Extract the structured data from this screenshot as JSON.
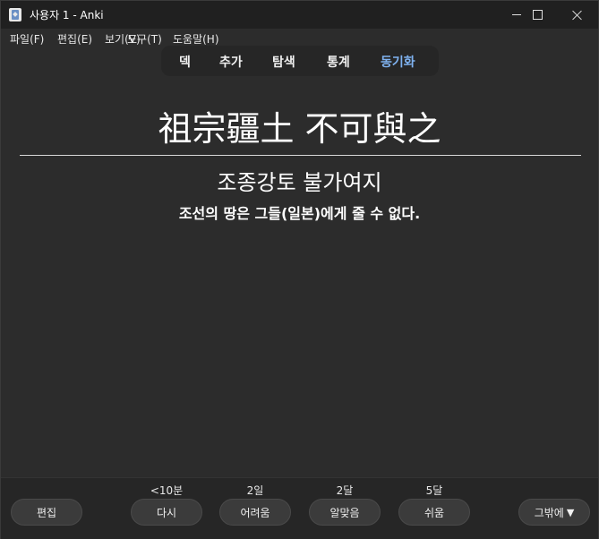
{
  "window": {
    "title": "사용자 1 - Anki",
    "icon": "anki-app-icon"
  },
  "menu": {
    "items": [
      {
        "label": "파일(F)"
      },
      {
        "label": "편집(E)"
      },
      {
        "label": "보기(V)"
      },
      {
        "label": "도구(T)"
      },
      {
        "label": "도움말(H)"
      }
    ]
  },
  "toolbar": {
    "links": [
      {
        "label": "덱"
      },
      {
        "label": "추가"
      },
      {
        "label": "탐색"
      },
      {
        "label": "통계"
      },
      {
        "label": "동기화"
      }
    ],
    "sync_color": "#7fb2f0"
  },
  "card": {
    "front": "祖宗疆土 不可與之",
    "reading": "조종강토 불가여지",
    "meaning": "조선의 땅은 그들(일본)에게 줄 수 없다."
  },
  "bottom": {
    "edit_label": "편집",
    "more_label": "그밖에",
    "more_icon": "triangle-down-icon",
    "answers": [
      {
        "interval": "<10분",
        "label": "다시"
      },
      {
        "interval": "2일",
        "label": "어려움"
      },
      {
        "interval": "2달",
        "label": "알맞음"
      },
      {
        "interval": "5달",
        "label": "쉬움"
      }
    ]
  },
  "colors": {
    "background": "#2c2c2c",
    "titlebar": "#202020",
    "button": "#3b3b3b"
  }
}
